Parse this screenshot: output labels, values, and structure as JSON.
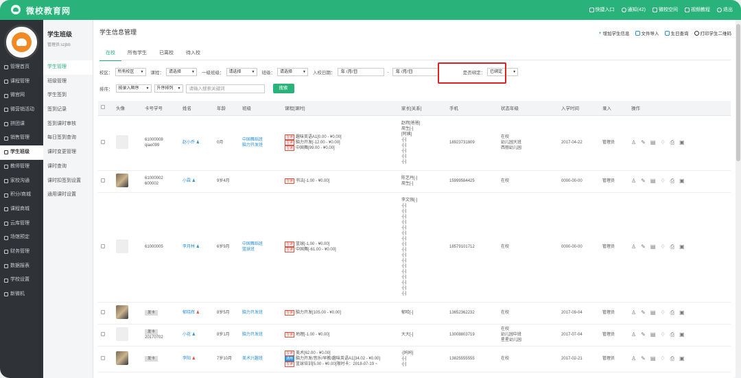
{
  "app": {
    "title": "微校教育网"
  },
  "topnav": [
    "快捷入口",
    "通知(42)",
    "微校空间",
    "视频教程",
    "退出"
  ],
  "user": {
    "title": "学生班级",
    "subtitle": "管理员:szjbb"
  },
  "sidebar_main": [
    {
      "label": "管理首页",
      "icon": "home-icon"
    },
    {
      "label": "课程管理",
      "icon": "course-icon"
    },
    {
      "label": "微官网",
      "icon": "site-icon"
    },
    {
      "label": "微营销活动",
      "icon": "marketing-icon"
    },
    {
      "label": "拼团课",
      "icon": "group-icon"
    },
    {
      "label": "销售管理",
      "icon": "sales-icon"
    },
    {
      "label": "学生班级",
      "icon": "student-icon"
    },
    {
      "label": "教师管理",
      "icon": "teacher-icon"
    },
    {
      "label": "家校沟通",
      "icon": "chat-icon"
    },
    {
      "label": "积分/商城",
      "icon": "points-icon"
    },
    {
      "label": "课程商城",
      "icon": "mall-icon"
    },
    {
      "label": "云库管理",
      "icon": "cloud-icon"
    },
    {
      "label": "场馆预定",
      "icon": "venue-icon"
    },
    {
      "label": "财务管理",
      "icon": "finance-icon"
    },
    {
      "label": "数据报表",
      "icon": "report-icon"
    },
    {
      "label": "学校设置",
      "icon": "settings-icon"
    },
    {
      "label": "新微机",
      "icon": "device-icon"
    }
  ],
  "sidebar_sub": [
    "学生管理",
    "班级管理",
    "学生签到",
    "签到记录",
    "签到课时审核",
    "每日签到查询",
    "课时变更管理",
    "课时查询",
    "课时扣签到设置",
    "通用课时设置"
  ],
  "page": {
    "title": "学生信息管理"
  },
  "actions": [
    "增加学生信息",
    "文件导入",
    "生日查询",
    "打印学生二维码"
  ],
  "tabs": [
    "在校",
    "所有学生",
    "已离校",
    "待入校"
  ],
  "filter": {
    "campus_label": "校区：",
    "campus_value": "所有校区",
    "course_label": "课程：",
    "course_value": "请选择",
    "class1_label": "一级班级：",
    "class1_value": "请选择",
    "class_label": "班级：",
    "class_value": "请选择",
    "date_label": "入校日期：",
    "date_from": "年 /月/日",
    "date_sep": "-",
    "date_to": "年 /月/日",
    "bind_label": "是否绑定：",
    "bind_value": "已绑定"
  },
  "sort": {
    "label": "排序：",
    "order_value": "按录入顺序",
    "dir_value": "升序排列",
    "search_placeholder": "请输入搜索关键词",
    "search_button": "搜索"
  },
  "table": {
    "headers": [
      "",
      "头像",
      "卡号学号",
      "姓名",
      "年龄",
      "班级",
      "课程[课时]",
      "家长[关系]",
      "手机",
      "状态年级",
      "入学时间",
      "录入",
      "操作"
    ],
    "rows": [
      {
        "card": [
          "61000008",
          "qiao099"
        ],
        "name": "赵小乔",
        "gender": "m",
        "age": "0月",
        "classes": [
          "中国舞蹈班",
          "脑力开发班"
        ],
        "courses": [
          [
            "在读",
            "趣味英语A1[0.00 - ¥0.00]"
          ],
          [
            "在读",
            "脑力开发[-12.00 - ¥0.00]"
          ],
          [
            "在读",
            "中国舞[99.00 - ¥0.00]"
          ]
        ],
        "parents": [
          "赵辉[爸爸]",
          "周生[-]",
          "[阿姨]",
          "-[-]",
          "-[-]",
          "-[-]",
          "-[-]",
          "-[-]"
        ],
        "phone": "18923731809",
        "status": [
          "在校",
          "幼儿园大班",
          "西丽幼儿园"
        ],
        "date": "2017-04-22",
        "by": "管理员",
        "photo": false
      },
      {
        "card": [
          "61000002",
          "600002"
        ],
        "name": "小霖",
        "gender": "m",
        "age": "9岁4月",
        "classes": [],
        "courses": [
          [
            "在读",
            "书法[-1.00 - ¥0.00]"
          ]
        ],
        "parents": [
          "陈艺丹[-]",
          "周生[-]"
        ],
        "phone": "15999584425",
        "status": [
          "在校"
        ],
        "date": "0000-00-00",
        "by": "管理员",
        "photo": true
      },
      {
        "card": [
          "61000005"
        ],
        "name": "李月林",
        "gender": "m",
        "age": "6岁9月",
        "classes": [
          "中国舞蹈班",
          "篮球班"
        ],
        "courses": [
          [
            "在读",
            "篮球[-1.00 - ¥0.00]"
          ],
          [
            "在读",
            "中国舞[-61.00 - ¥0.00]"
          ]
        ],
        "parents": [
          "李文强[-]",
          "-[-]",
          "-[-]",
          "-[-]",
          "-[-]",
          "-[-]",
          "-[-]",
          "-[-]",
          "-[-]",
          "-[-]",
          "-[-]",
          "-[-]",
          "-[-]",
          "-[-]",
          "-[-]",
          "-[-]",
          "-[-]",
          "-[-]"
        ],
        "phone": "18579101712",
        "status": [
          "在校"
        ],
        "date": "0000-00-00",
        "by": "管理员",
        "photo": false
      },
      {
        "card": [
          "发卡"
        ],
        "name": "郁晓辉",
        "gender": "f",
        "age": "8岁5月",
        "classes": [
          "脑力开发班"
        ],
        "courses": [
          [
            "在读",
            "脑力开发[105.00 - ¥0.00]"
          ]
        ],
        "parents": [
          "郁哈[-]"
        ],
        "phone": "13652362232",
        "status": [
          "在校"
        ],
        "date": "2017-09-04",
        "by": "管理员",
        "photo": true
      },
      {
        "card": [
          "发卡",
          "20170702"
        ],
        "name": "小花",
        "gender": "m",
        "age": "8岁1月",
        "classes": [
          "脑力开发班"
        ],
        "courses": [
          [
            "在读",
            "地理[-1.00 - ¥0.00]"
          ]
        ],
        "parents": [
          "大大[-]"
        ],
        "phone": "13008803719",
        "status": [
          "在校",
          "幼儿园中班",
          "星星幼儿园"
        ],
        "date": "2017-07-04",
        "by": "管理员",
        "photo": false
      },
      {
        "card": [
          "发卡"
        ],
        "name": "李阳",
        "gender": "f",
        "age": "7岁10月",
        "classes": [
          "美术兴趣班"
        ],
        "courses": [
          [
            "在读",
            "美术[62.00 - ¥0.00]"
          ],
          [
            "通用",
            "脑力开发/音乐/早教/趣味英语A1[34.02 - ¥0.00]"
          ],
          [
            "在读",
            "篮球培训[5.00 - ¥0.00]限时卡：2018-07-19 ~"
          ]
        ],
        "parents": [
          "-[妈妈]",
          "-[-]",
          "-[-]"
        ],
        "phone": "13825555555",
        "status": [
          "在校"
        ],
        "date": "2017-02-21",
        "by": "管理员",
        "photo": true
      }
    ]
  }
}
